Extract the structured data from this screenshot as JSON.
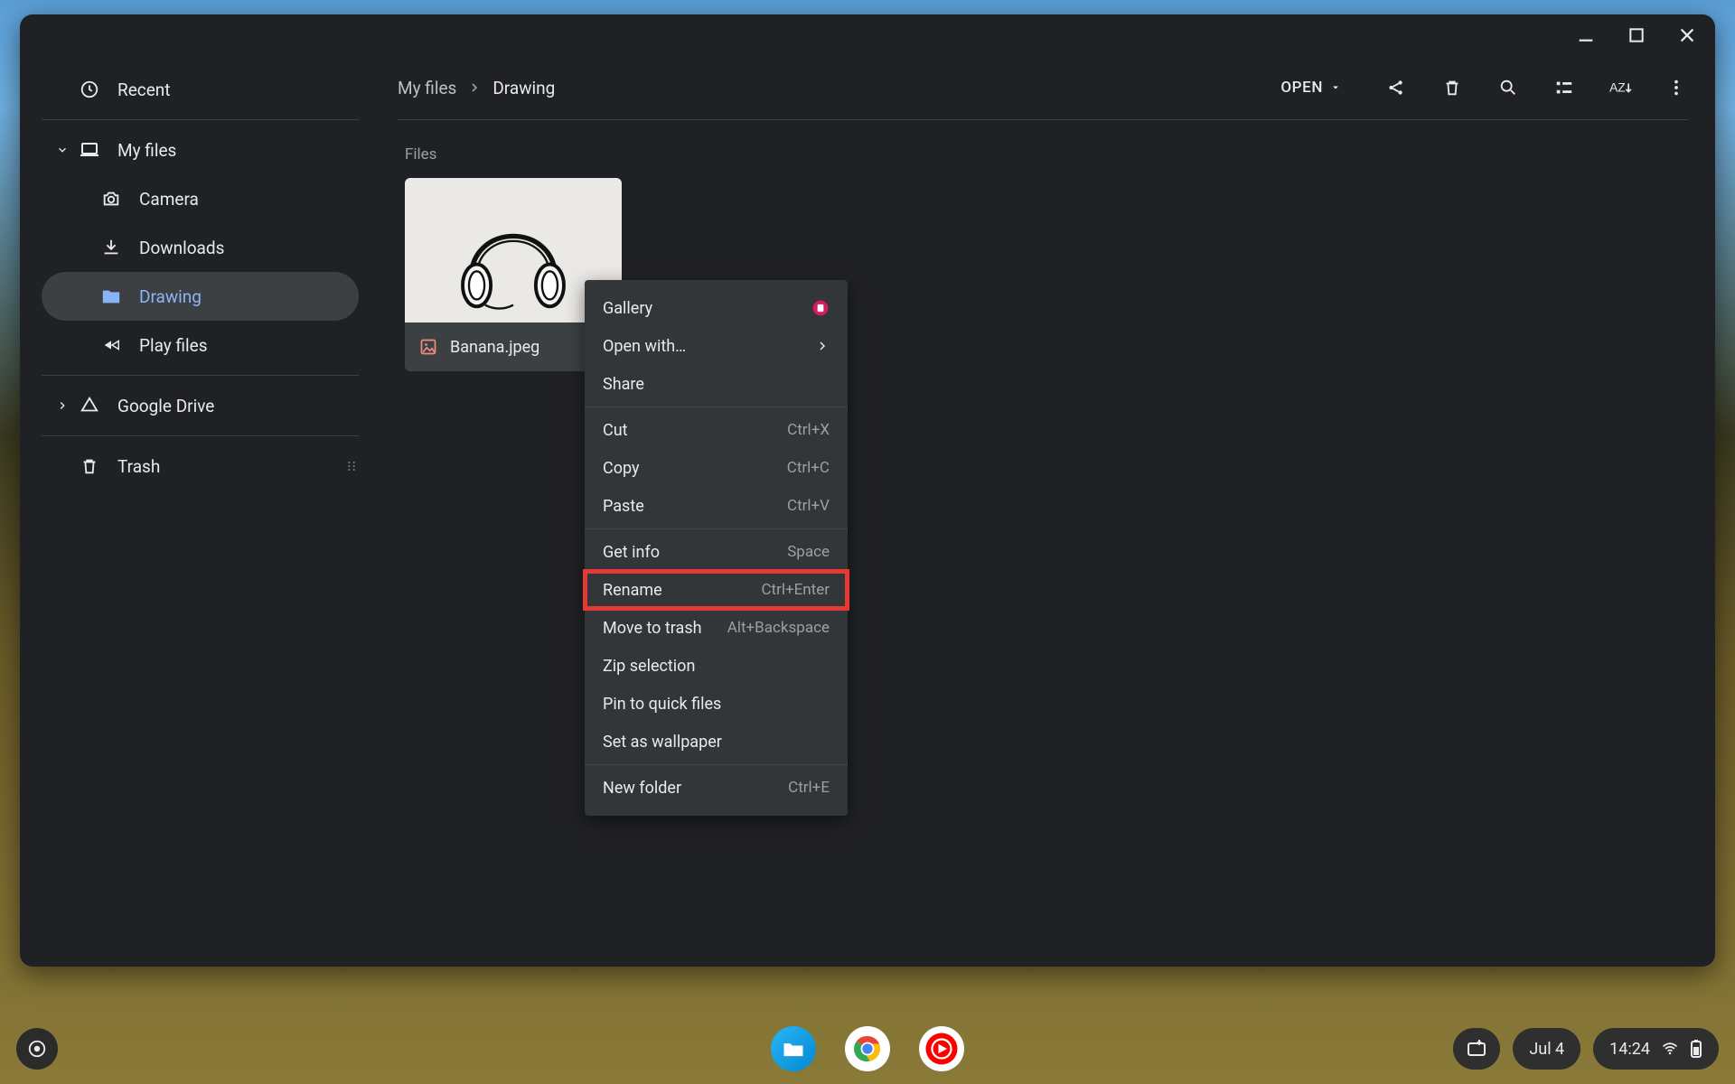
{
  "window_controls": {
    "minimize": "minimize",
    "maximize": "maximize",
    "close": "close"
  },
  "sidebar": {
    "recent": "Recent",
    "myfiles": "My files",
    "children": [
      {
        "label": "Camera"
      },
      {
        "label": "Downloads"
      },
      {
        "label": "Drawing"
      },
      {
        "label": "Play files"
      }
    ],
    "gdrive": "Google Drive",
    "trash": "Trash"
  },
  "breadcrumb": {
    "root": "My files",
    "current": "Drawing"
  },
  "toolbar": {
    "open_label": "OPEN"
  },
  "section": {
    "files_label": "Files"
  },
  "file": {
    "name": "Banana.jpeg"
  },
  "context_menu": {
    "gallery": "Gallery",
    "open_with": "Open with…",
    "share": "Share",
    "cut": "Cut",
    "cut_sc": "Ctrl+X",
    "copy": "Copy",
    "copy_sc": "Ctrl+C",
    "paste": "Paste",
    "paste_sc": "Ctrl+V",
    "get_info": "Get info",
    "get_info_sc": "Space",
    "rename": "Rename",
    "rename_sc": "Ctrl+Enter",
    "move_trash": "Move to trash",
    "move_trash_sc": "Alt+Backspace",
    "zip": "Zip selection",
    "pin": "Pin to quick files",
    "wallpaper": "Set as wallpaper",
    "new_folder": "New folder",
    "new_folder_sc": "Ctrl+E"
  },
  "shelf": {
    "date": "Jul 4",
    "time": "14:24"
  }
}
